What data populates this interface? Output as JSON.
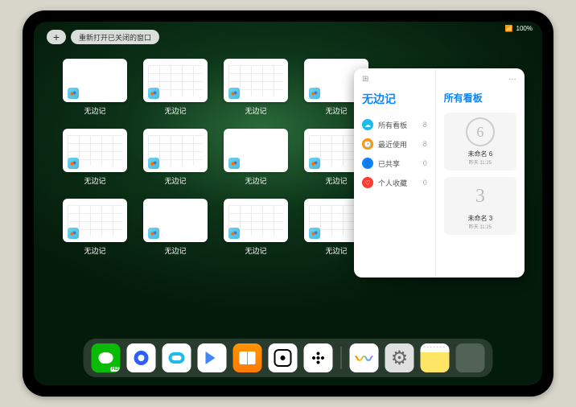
{
  "status": {
    "signal": "📶",
    "battery": "100%"
  },
  "topbar": {
    "plus": "+",
    "reopen": "重新打开已关闭的窗口"
  },
  "windows": [
    {
      "label": "无边记",
      "style": "plain"
    },
    {
      "label": "无边记",
      "style": "grid"
    },
    {
      "label": "无边记",
      "style": "grid"
    },
    {
      "label": "无边记",
      "style": "plain"
    },
    {
      "label": "无边记",
      "style": "grid"
    },
    {
      "label": "无边记",
      "style": "grid"
    },
    {
      "label": "无边记",
      "style": "plain"
    },
    {
      "label": "无边记",
      "style": "grid"
    },
    {
      "label": "无边记",
      "style": "grid"
    },
    {
      "label": "无边记",
      "style": "plain"
    },
    {
      "label": "无边记",
      "style": "grid"
    },
    {
      "label": "无边记",
      "style": "grid"
    }
  ],
  "panel": {
    "icon": "⊞",
    "more": "···",
    "title": "无边记",
    "categories": [
      {
        "icon": "☁",
        "color": "#1ebaed",
        "label": "所有看板",
        "count": "8"
      },
      {
        "icon": "🕑",
        "color": "#ff9500",
        "label": "最近使用",
        "count": "8"
      },
      {
        "icon": "👤",
        "color": "#0a84ff",
        "label": "已共享",
        "count": "0"
      },
      {
        "icon": "♡",
        "color": "#ff3b30",
        "label": "个人收藏",
        "count": "0"
      }
    ],
    "right_title": "所有看板",
    "boards": [
      {
        "doodle": "6",
        "name": "未命名 6",
        "date": "昨天 11:25"
      },
      {
        "doodle": "3",
        "name": "未命名 3",
        "date": "昨天 11:25"
      }
    ]
  },
  "dock": [
    "wechat",
    "quark",
    "ucloud",
    "play",
    "books",
    "dice",
    "atom",
    "|",
    "freeform",
    "settings",
    "notes",
    "multi"
  ]
}
